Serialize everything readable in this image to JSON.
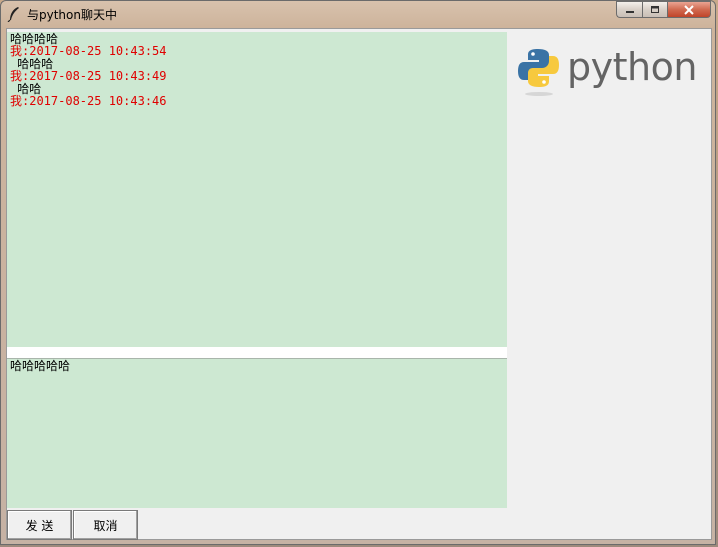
{
  "window": {
    "title": "与python聊天中",
    "controls": [
      "minimize-icon",
      "maximize-icon",
      "close-icon"
    ]
  },
  "chat_log": {
    "top_line": "哈哈哈哈",
    "messages": [
      {
        "header": "我:2017-08-25 10:43:54",
        "body": " 哈哈哈"
      },
      {
        "header": "我:2017-08-25 10:43:49",
        "body": " 哈哈"
      },
      {
        "header": "我:2017-08-25 10:43:46",
        "body": ""
      }
    ]
  },
  "input": {
    "value": "哈哈哈哈哈"
  },
  "buttons": {
    "send_label": "发 送",
    "cancel_label": "取消"
  },
  "logo": {
    "text": "python"
  },
  "colors": {
    "chat_bg": "#cde8d2",
    "timestamp_red": "#e00000",
    "window_bg": "#f0f0f0"
  }
}
